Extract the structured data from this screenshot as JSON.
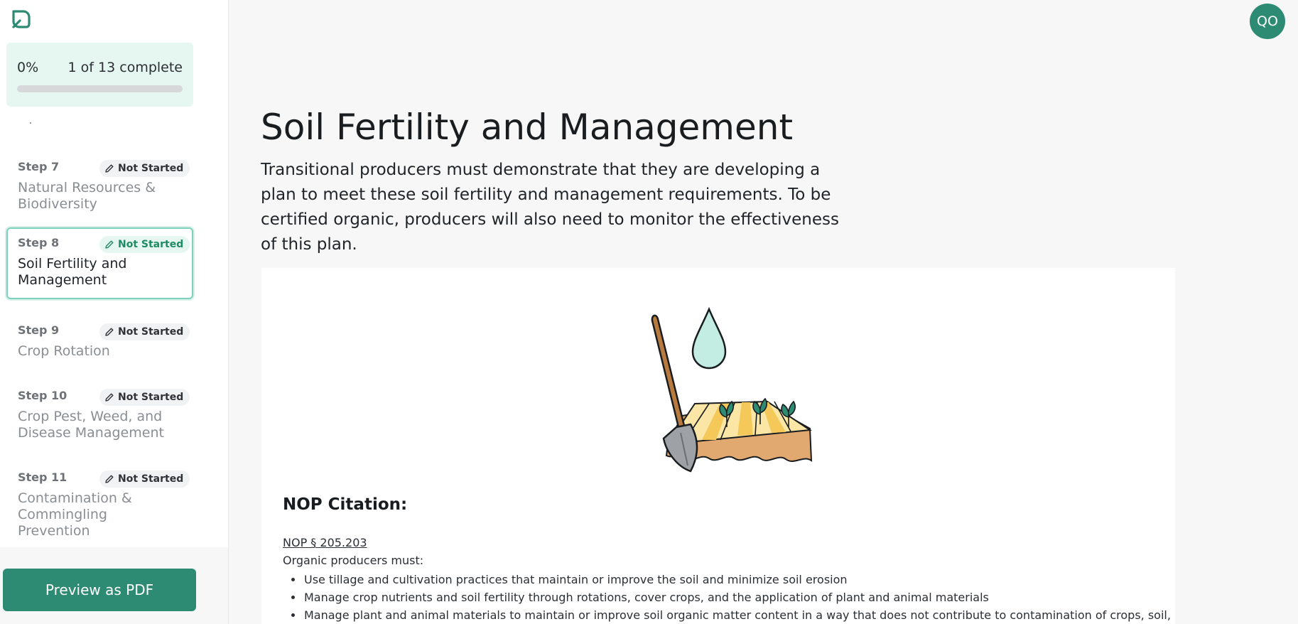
{
  "sidebar": {
    "progress": {
      "percent_label": "0%",
      "count_label": "1 of 13 complete",
      "fraction": 0
    },
    "steps": [
      {
        "num": "Step 7",
        "status": "Not Started",
        "title": "Natural Resources & Biodiversity"
      },
      {
        "num": "Step 8",
        "status": "Not Started",
        "title": "Soil Fertility and Management"
      },
      {
        "num": "Step 9",
        "status": "Not Started",
        "title": "Crop Rotation"
      },
      {
        "num": "Step 10",
        "status": "Not Started",
        "title": "Crop Pest, Weed, and Disease Management"
      },
      {
        "num": "Step 11",
        "status": "Not Started",
        "title": "Contamination & Commingling Prevention"
      }
    ],
    "pdf_button": "Preview as PDF"
  },
  "header": {
    "avatar_initials": "QO"
  },
  "main": {
    "title": "Soil Fertility and Management",
    "description": "Transitional producers must demonstrate that they are developing a plan to meet these soil fertility and management requirements. To be certified organic, producers will also need to monitor the effectiveness of this plan.",
    "citation": {
      "heading": "NOP Citation:",
      "link": "NOP § 205.203",
      "intro": "Organic producers must:",
      "items": [
        "Use tillage and cultivation practices that maintain or improve the soil and minimize soil erosion",
        "Manage crop nutrients and soil fertility through rotations, cover crops, and the application of plant and animal materials",
        "Manage plant and animal materials to maintain or improve soil organic matter content in a way that does not contribute to contamination of crops, soil,"
      ]
    }
  },
  "colors": {
    "brand": "#2e8b73",
    "active_badge_bg": "#e6f7f1",
    "active_border": "#7fd1bb"
  },
  "icons": {
    "logo": "leaf-logo-icon",
    "badge": "pencil-icon"
  }
}
